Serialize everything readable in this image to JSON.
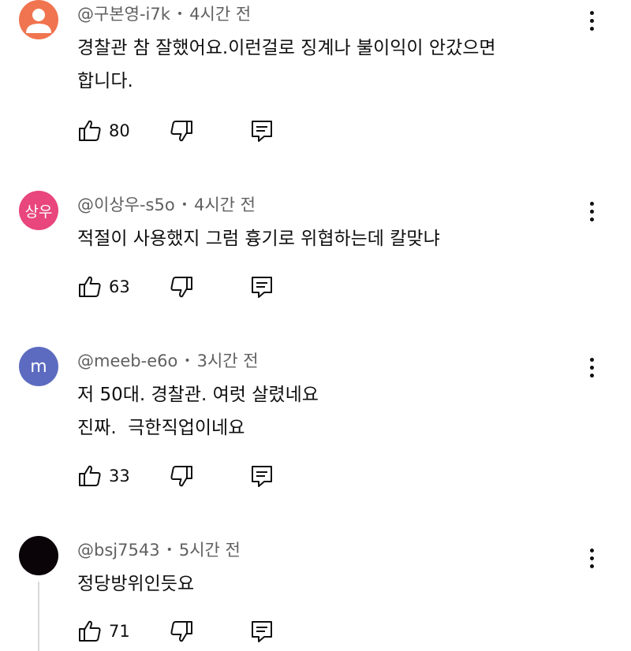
{
  "comments": [
    {
      "avatar_text": "",
      "avatar_color": "#f0744f",
      "avatar_type": "default-person",
      "username": "@구본영-i7k",
      "time": "4시간 전",
      "lines": [
        "경찰관 참 잘했어요.이런걸로 징계나 불이익이 안갔으면",
        "합니다."
      ],
      "likes": "80"
    },
    {
      "avatar_text": "상우",
      "avatar_color": "#e8467c",
      "username": "@이상우-s5o",
      "time": "4시간 전",
      "lines": [
        "적절이 사용했지 그럼 흉기로 위협하는데 칼맞냐"
      ],
      "likes": "63"
    },
    {
      "avatar_text": "m",
      "avatar_color": "#5c6bc0",
      "username": "@meeb-e6o",
      "time": "3시간 전",
      "lines": [
        "저 50대. 경찰관. 여럿 살렸네요",
        "진짜.  극한직업이네요"
      ],
      "likes": "33"
    },
    {
      "avatar_text": "",
      "avatar_color": "#0a0308",
      "username": "@bsj7543",
      "time": "5시간 전",
      "lines": [
        "정당방위인듯요"
      ],
      "likes": "71"
    }
  ],
  "icons": {
    "like": "thumbs-up-icon",
    "dislike": "thumbs-down-icon",
    "reply": "reply-comment-icon",
    "more": "more-vertical-icon"
  }
}
